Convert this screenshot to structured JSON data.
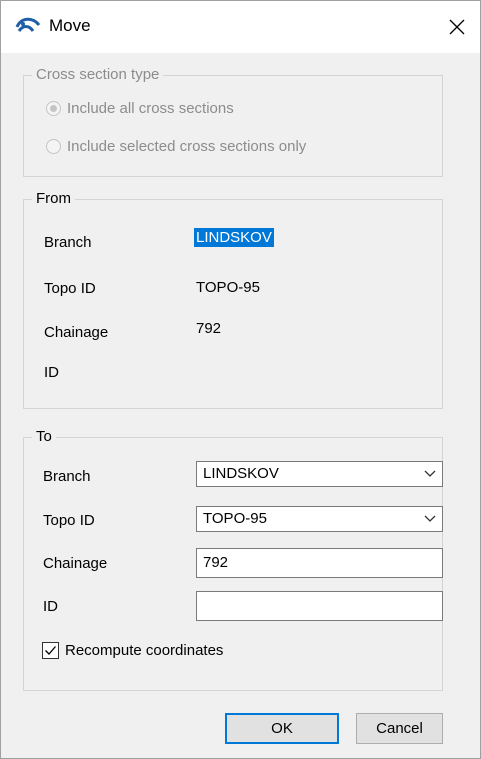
{
  "window": {
    "title": "Move"
  },
  "cross_section": {
    "legend": "Cross section type",
    "options": [
      {
        "label": "Include all cross sections",
        "checked": true
      },
      {
        "label": "Include selected cross sections only",
        "checked": false
      }
    ]
  },
  "from": {
    "legend": "From",
    "branch_label": "Branch",
    "branch_value": "LINDSKOV",
    "topo_label": "Topo ID",
    "topo_value": "TOPO-95",
    "chainage_label": "Chainage",
    "chainage_value": "792",
    "id_label": "ID",
    "id_value": ""
  },
  "to": {
    "legend": "To",
    "branch_label": "Branch",
    "branch_value": "LINDSKOV",
    "topo_label": "Topo ID",
    "topo_value": "TOPO-95",
    "chainage_label": "Chainage",
    "chainage_value": "792",
    "id_label": "ID",
    "id_value": "",
    "recompute_label": "Recompute coordinates",
    "recompute_checked": true
  },
  "buttons": {
    "ok": "OK",
    "cancel": "Cancel"
  },
  "colors": {
    "selection": "#0078d7",
    "accent_border": "#0078d7",
    "title_icon": "#1f5fa8"
  },
  "icons": {
    "app": "wave-icon",
    "close": "close-icon",
    "dropdown": "chevron-down-icon",
    "check": "checkmark-icon"
  }
}
